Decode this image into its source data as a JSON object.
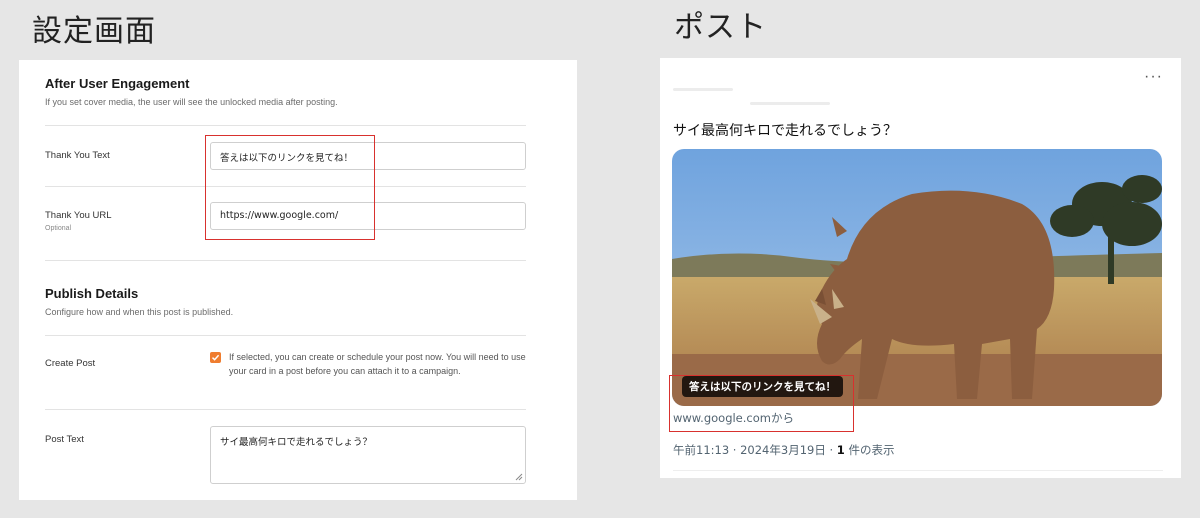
{
  "captions": {
    "left": "設定画面",
    "right": "ポスト"
  },
  "settings": {
    "after": {
      "title": "After User Engagement",
      "desc": "If you set cover media, the user will see the unlocked media after posting."
    },
    "thank_text": {
      "label": "Thank You Text",
      "value": "答えは以下のリンクを見てね！"
    },
    "thank_url": {
      "label": "Thank You URL",
      "sub": "Optional",
      "value": "https://www.google.com/"
    },
    "publish": {
      "title": "Publish Details",
      "desc": "Configure how and when this post is published."
    },
    "create_post": {
      "label": "Create Post",
      "checked": true,
      "text": "If selected, you can create or schedule your post now. You will need to use your card in a post before you can attach it to a campaign."
    },
    "post_text": {
      "label": "Post Text",
      "value": "サイ最高何キロで走れるでしょう？"
    }
  },
  "post": {
    "more_icon": "more-dots-icon",
    "text": "サイ最高何キロで走れるでしょう？",
    "image_overlay": "答えは以下のリンクを見てね！",
    "domain": "www.google.comから",
    "time": "午前11:13 · 2024年3月19日 · ",
    "views_count": "1",
    "views_suffix": " 件の表示"
  },
  "colors": {
    "highlight": "#d8312e",
    "checkbox": "#ef7d2f",
    "page_bg": "#e6e6e6"
  }
}
